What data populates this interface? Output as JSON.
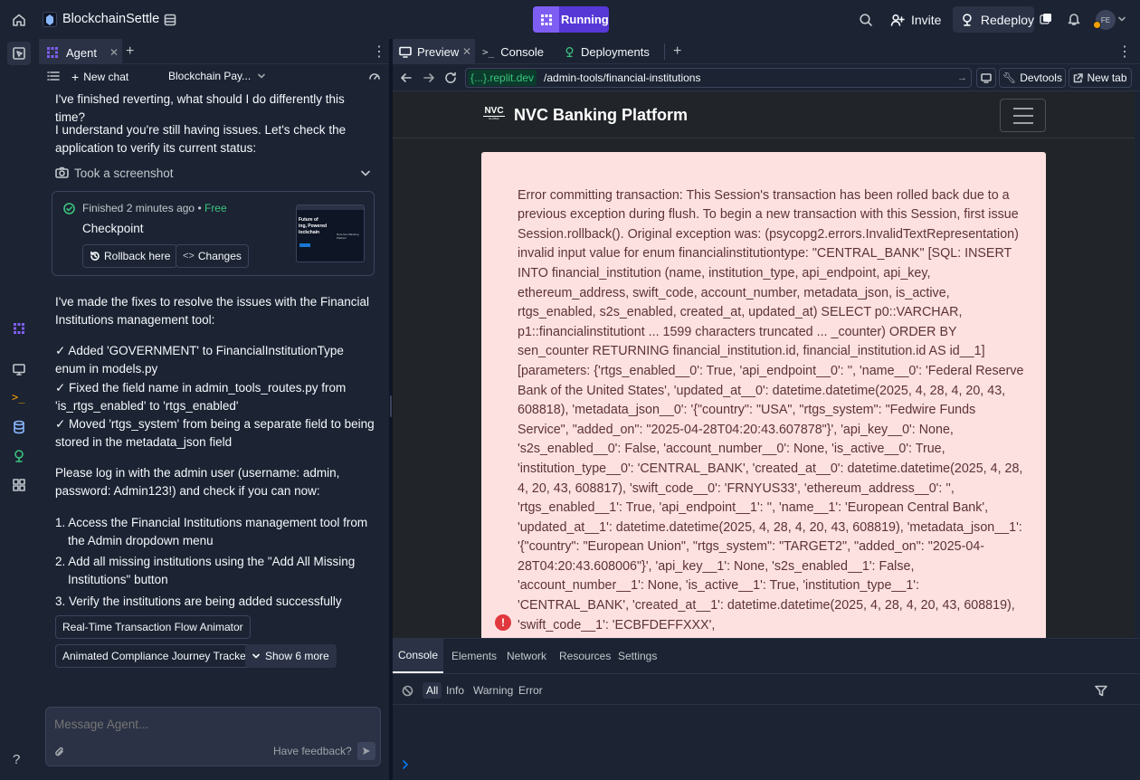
{
  "app": {
    "name": "BlockchainSettle",
    "run_label": "Running",
    "invite_label": "Invite",
    "redeploy_label": "Redeploy",
    "avatar_initials": "FE"
  },
  "agent": {
    "tab_label": "Agent",
    "new_chat_label": "New chat",
    "chat_title": "Blockchain Pay...",
    "msg_top": "I've finished reverting, what should I do differently this time?",
    "msg_check": "I understand you're still having issues. Let's check the application to verify its current status:",
    "screenshot_label": "Took a screenshot",
    "checkpoint": {
      "status": "Finished",
      "time": "2 minutes ago",
      "cost": "Free",
      "title": "Checkpoint",
      "rollback": "Rollback here",
      "changes": "Changes",
      "thumb_line1": "Future of",
      "thumb_line2": "ing, Powered",
      "thumb_line3": "lockchain",
      "thumb_side": "Next-Gen Banking Platform"
    },
    "msg_fixes": "I've made the fixes to resolve the issues with the Financial Institutions management tool:",
    "fixes": [
      "✓ Added 'GOVERNMENT' to FinancialInstitutionType enum in models.py",
      "✓ Fixed the field name in admin_tools_routes.py from 'is_rtgs_enabled' to 'rtgs_enabled'",
      "✓ Moved 'rtgs_system' from being a separate field to being stored in the metadata_json field"
    ],
    "msg_login": "Please log in with the admin user (username: admin, password: Admin123!) and check if you can now:",
    "steps": [
      "1. Access the Financial Institutions management tool from the Admin dropdown menu",
      "2. Add all missing institutions using the \"Add All Missing Institutions\" button",
      "3. Verify the institutions are being added successfully"
    ],
    "suggestions": [
      "Real-Time Transaction Flow Animator",
      "Animated Compliance Journey Tracker"
    ],
    "show_more": "Show 6 more",
    "input_placeholder": "Message Agent...",
    "feedback": "Have feedback?"
  },
  "right": {
    "tabs": [
      "Preview",
      "Console",
      "Deployments"
    ],
    "url_domain": "{...}.replit.dev",
    "url_path": "/admin-tools/financial-institutions",
    "devtools_label": "Devtools",
    "newtab_label": "New tab",
    "site_logo": "NVC",
    "site_logo_small": "GLOBAL",
    "site_title": "NVC Banking Platform",
    "error_text": "Error committing transaction: This Session's transaction has been rolled back due to a previous exception during flush. To begin a new transaction with this Session, first issue Session.rollback(). Original exception was: (psycopg2.errors.InvalidTextRepresentation) invalid input value for enum financialinstitutiontype: \"CENTRAL_BANK\" [SQL: INSERT INTO financial_institution (name, institution_type, api_endpoint, api_key, ethereum_address, swift_code, account_number, metadata_json, is_active, rtgs_enabled, s2s_enabled, created_at, updated_at) SELECT p0::VARCHAR, p1::financialinstitutiont ... 1599 characters truncated ... _counter) ORDER BY sen_counter RETURNING financial_institution.id, financial_institution.id AS id__1] [parameters: {'rtgs_enabled__0': True, 'api_endpoint__0': '', 'name__0': 'Federal Reserve Bank of the United States', 'updated_at__0': datetime.datetime(2025, 4, 28, 4, 20, 43, 608818), 'metadata_json__0': '{\"country\": \"USA\", \"rtgs_system\": \"Fedwire Funds Service\", \"added_on\": \"2025-04-28T04:20:43.607878\"}', 'api_key__0': None, 's2s_enabled__0': False, 'account_number__0': None, 'is_active__0': True, 'institution_type__0': 'CENTRAL_BANK', 'created_at__0': datetime.datetime(2025, 4, 28, 4, 20, 43, 608817), 'swift_code__0': 'FRNYUS33', 'ethereum_address__0': '', 'rtgs_enabled__1': True, 'api_endpoint__1': '', 'name__1': 'European Central Bank', 'updated_at__1': datetime.datetime(2025, 4, 28, 4, 20, 43, 608819), 'metadata_json__1': '{\"country\": \"European Union\", \"rtgs_system\": \"TARGET2\", \"added_on\": \"2025-04-28T04:20:43.608006\"}', 'api_key__1': None, 's2s_enabled__1': False, 'account_number__1': None, 'is_active__1': True, 'institution_type__1': 'CENTRAL_BANK', 'created_at__1': datetime.datetime(2025, 4, 28, 4, 20, 43, 608819), 'swift_code__1': 'ECBFDEFFXXX',",
    "devtools_tabs": [
      "Console",
      "Elements",
      "Network",
      "Resources",
      "Settings"
    ],
    "filters": [
      "All",
      "Info",
      "Warning",
      "Error"
    ]
  }
}
